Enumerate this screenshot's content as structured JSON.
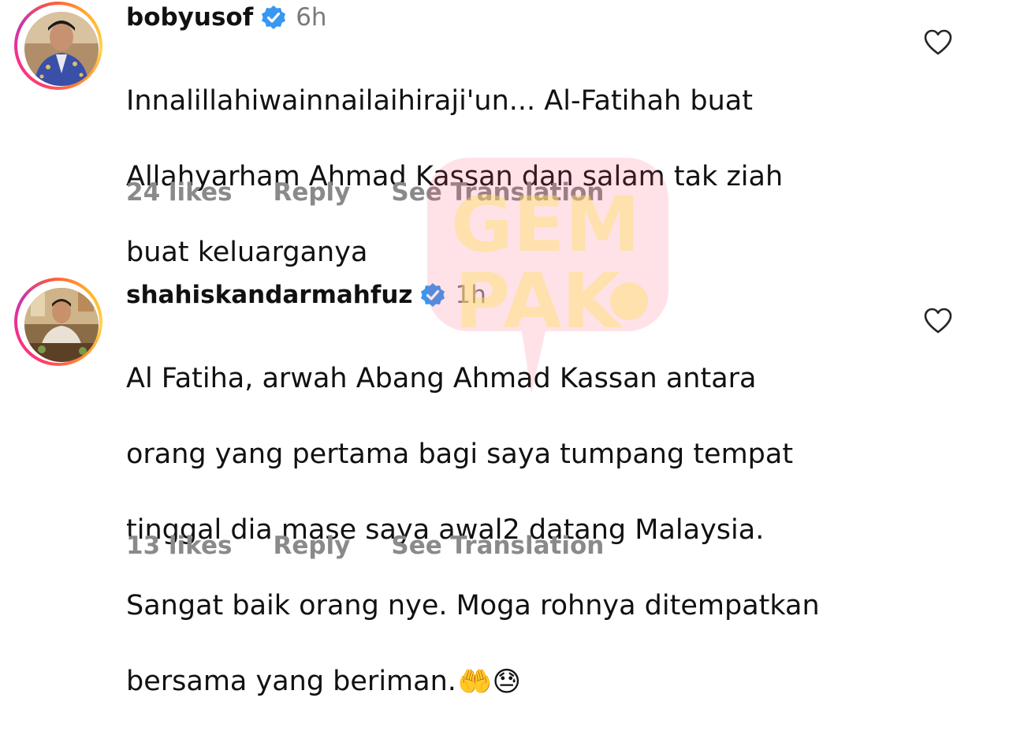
{
  "comments": [
    {
      "username": "bobyusof",
      "verified": true,
      "time": "6h",
      "lines": [
        "Innalillahiwainnailaihiraji'un... Al-Fatihah buat",
        "Allahyarham Ahmad Kassan dan salam tak ziah",
        "buat keluarganya"
      ],
      "likes": "24 likes",
      "reply": "Reply",
      "translate": "See Translation"
    },
    {
      "username": "shahiskandarmahfuz",
      "verified": true,
      "time": "1h",
      "lines": [
        "Al Fatiha, arwah Abang Ahmad Kassan antara",
        "orang yang pertama bagi saya tumpang tempat",
        "tinggal dia mase saya awal2 datang Malaysia.",
        "Sangat baik orang nye. Moga rohnya ditempatkan",
        "bersama yang beriman."
      ],
      "emojis": "🤲😓",
      "likes": "13 likes",
      "reply": "Reply",
      "translate": "See Translation"
    }
  ],
  "watermark": {
    "line1": "GEM",
    "line2": "PAK"
  },
  "colors": {
    "verified": "#3897f0",
    "meta": "#8a8a8a",
    "time": "#7a7a7a",
    "watermark_bg": "#ff4d6d"
  },
  "icons": {
    "like": "heart-outline-icon",
    "verified": "verified-badge-icon"
  }
}
